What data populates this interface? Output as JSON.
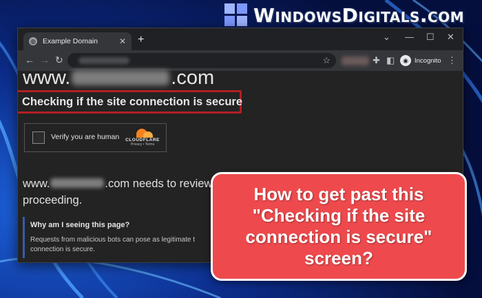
{
  "watermark": {
    "text": "WindowsDigitals.com"
  },
  "browser": {
    "tab_title": "Example Domain",
    "tab_favicon": "globe-icon",
    "new_tab_label": "+",
    "incognito_label": "Incognito",
    "window_controls": [
      "chevron-down-icon",
      "minimize-icon",
      "maximize-icon",
      "close-icon"
    ]
  },
  "page": {
    "heading_prefix": "www.",
    "heading_suffix": ".com",
    "checking_text": "Checking if the site connection is secure",
    "captcha": {
      "label": "Verify you are human",
      "brand": "CLOUDFLARE",
      "links": "Privacy • Terms"
    },
    "review_prefix": "www.",
    "review_suffix": ".com needs to review",
    "review_line2": "proceeding.",
    "why_title": "Why am I seeing this page?",
    "why_body_line1": "Requests from malicious bots can pose as legitimate t",
    "why_body_line2": "connection is secure."
  },
  "callout": {
    "text": "How to get past this\n\"Checking if the site\nconnection is secure\"\nscreen?",
    "color": "#ee4a4d"
  },
  "colors": {
    "highlight_border": "#b21f24",
    "wallpaper": "#0a1f63"
  }
}
